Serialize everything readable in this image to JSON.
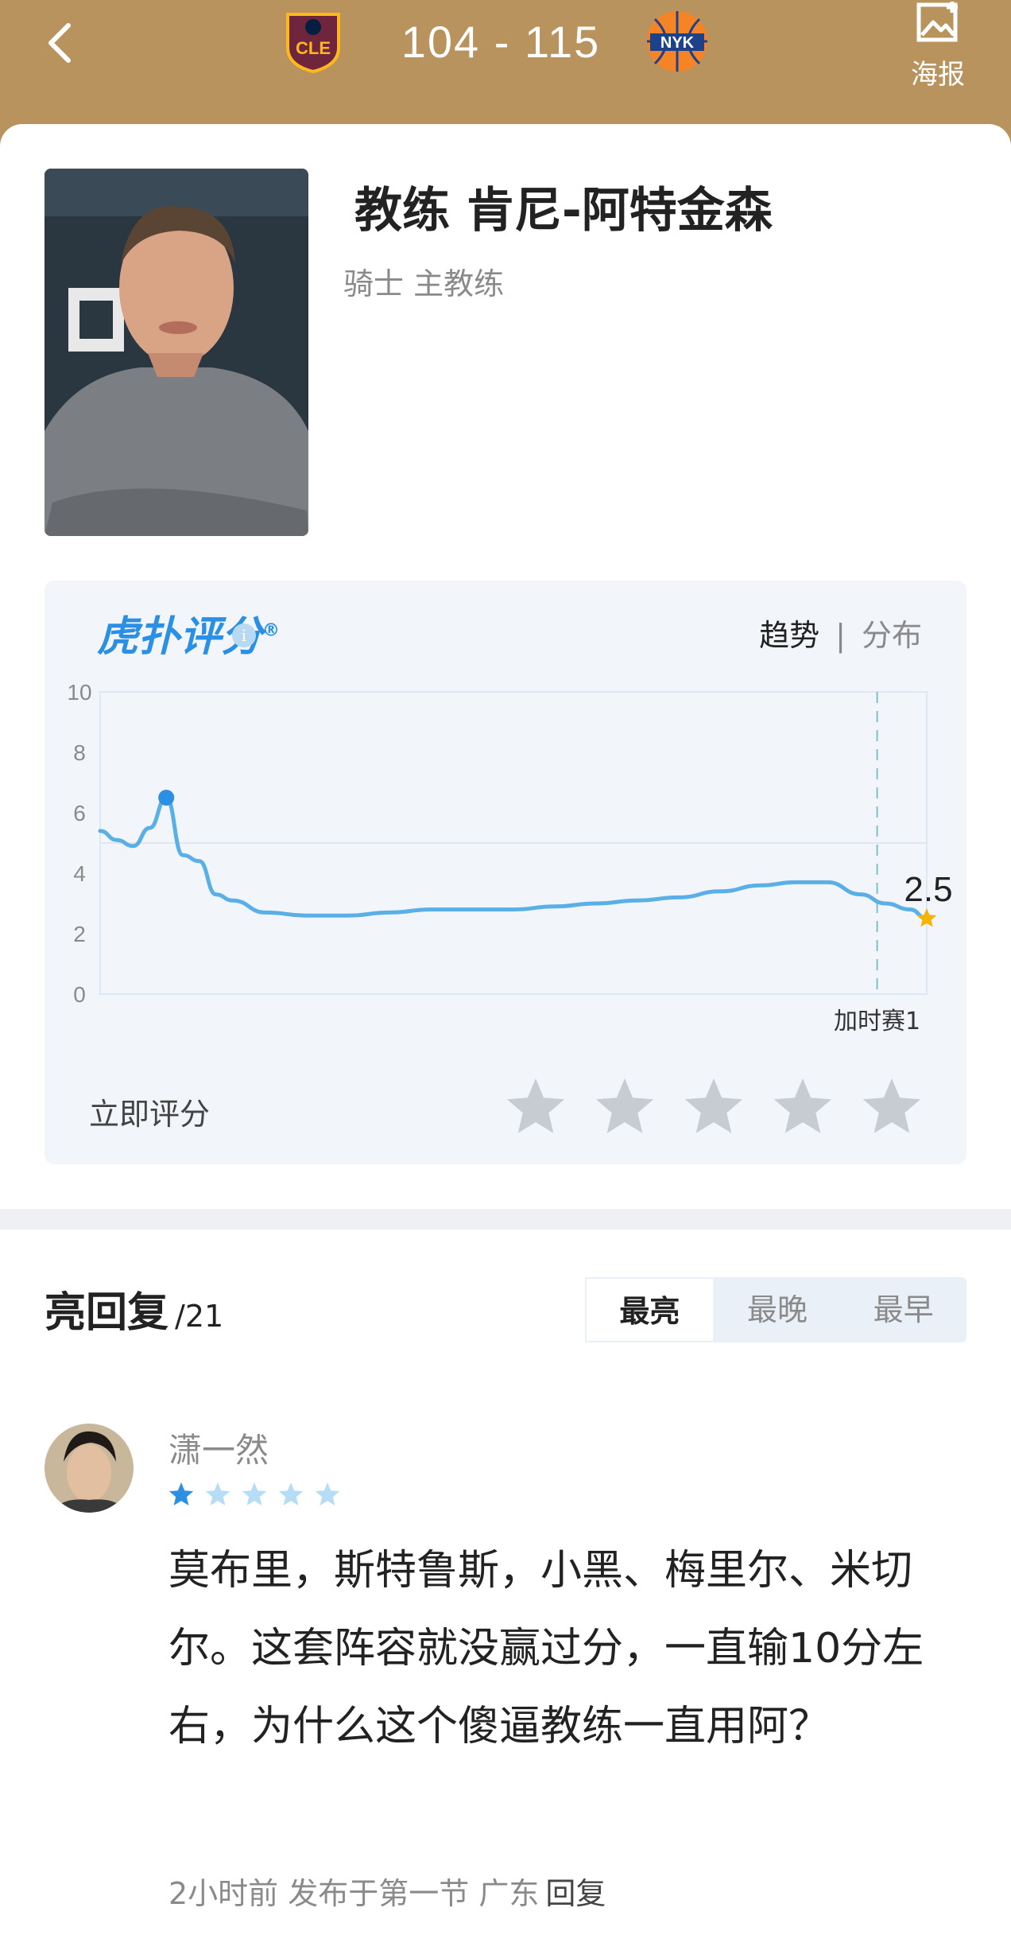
{
  "header": {
    "score": "104 - 115",
    "home_team": "CLE",
    "away_team": "NYK",
    "poster_label": "海报"
  },
  "coach": {
    "name": "教练 肯尼-阿特金森",
    "role": "骑士 主教练"
  },
  "rating_panel": {
    "brand": "虎扑评分",
    "brand_mark": "®",
    "tab_trend": "趋势",
    "tab_separator": "|",
    "tab_distribution": "分布",
    "rate_now_label": "立即评分",
    "stars": 5
  },
  "chart_data": {
    "type": "line",
    "ylim": [
      0,
      10
    ],
    "yticks": [
      "10",
      "8",
      "6",
      "4",
      "2",
      "0"
    ],
    "overtime_label": "加时赛1",
    "final_value_label": "2.5",
    "series": [
      {
        "x": [
          0,
          2,
          4,
          6,
          8,
          10,
          12,
          14,
          16,
          20,
          25,
          30,
          35,
          40,
          45,
          50,
          55,
          60,
          65,
          70,
          75,
          80,
          84,
          88,
          92,
          95,
          98,
          100
        ],
        "values": [
          5.4,
          5.1,
          4.9,
          5.5,
          6.5,
          4.6,
          4.4,
          3.3,
          3.1,
          2.7,
          2.6,
          2.6,
          2.7,
          2.8,
          2.8,
          2.8,
          2.9,
          3.0,
          3.1,
          3.2,
          3.4,
          3.6,
          3.7,
          3.7,
          3.3,
          3.0,
          2.8,
          2.5
        ]
      }
    ],
    "peak_x": 8,
    "overtime_x": 94,
    "colors": {
      "line": "#5ab0e6",
      "peak": "#2b8fe3",
      "final_star": "#f5b400"
    }
  },
  "comments": {
    "title": "亮回复",
    "count": "/21",
    "sort_tabs": [
      "最亮",
      "最晚",
      "最早"
    ],
    "items": [
      {
        "username": "潇一然",
        "rating": 1,
        "text": "莫布里，斯特鲁斯，小黑、梅里尔、米切尔。这套阵容就没赢过分，一直输10分左右，为什么这个傻逼教练一直用阿？",
        "meta": "2小时前 发布于第一节 广东",
        "reply": "回复"
      }
    ]
  }
}
